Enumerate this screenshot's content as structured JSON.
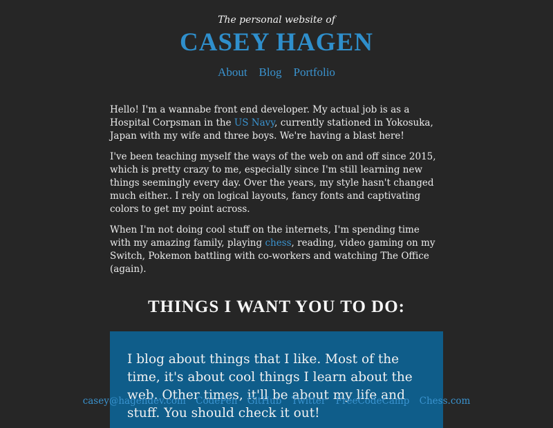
{
  "header": {
    "tagline": "The personal website of",
    "title": "CASEY HAGEN",
    "nav": [
      "About",
      "Blog",
      "Portfolio"
    ]
  },
  "intro": {
    "p1_a": "Hello! I'm a wannabe front end developer. My actual job is as a Hospital Corpsman in the ",
    "p1_link": "US Navy",
    "p1_b": ", currently stationed in Yokosuka, Japan with my wife and three boys. We're having a blast here!",
    "p2": "I've been teaching myself the ways of the web on and off since 2015, which is pretty crazy to me, especially since I'm still learning new things seemingly every day. Over the years, my style hasn't changed much either.. I rely on logical layouts, fancy fonts and captivating colors to get my point across.",
    "p3_a": "When I'm not doing cool stuff on the internets, I'm spending time with my amazing family, playing ",
    "p3_link": "chess",
    "p3_b": ", reading, video gaming on my Switch, Pokemon battling with co-workers and watching The Office (again)."
  },
  "section": {
    "heading": "THINGS I WANT YOU TO DO:",
    "card_text": "I blog about things that I like. Most of the time, it's about cool things I learn about the web. Other times, it'll be about my life and stuff. You should check it out!"
  },
  "footer": {
    "links": [
      "casey@hagendev.com",
      "CodePen",
      "GitHub",
      "Twitter",
      "FreeCodeCamp",
      "Chess.com"
    ]
  },
  "colors": {
    "background": "#262626",
    "accent": "#2f8fcc",
    "card": "#0f5d8a"
  }
}
